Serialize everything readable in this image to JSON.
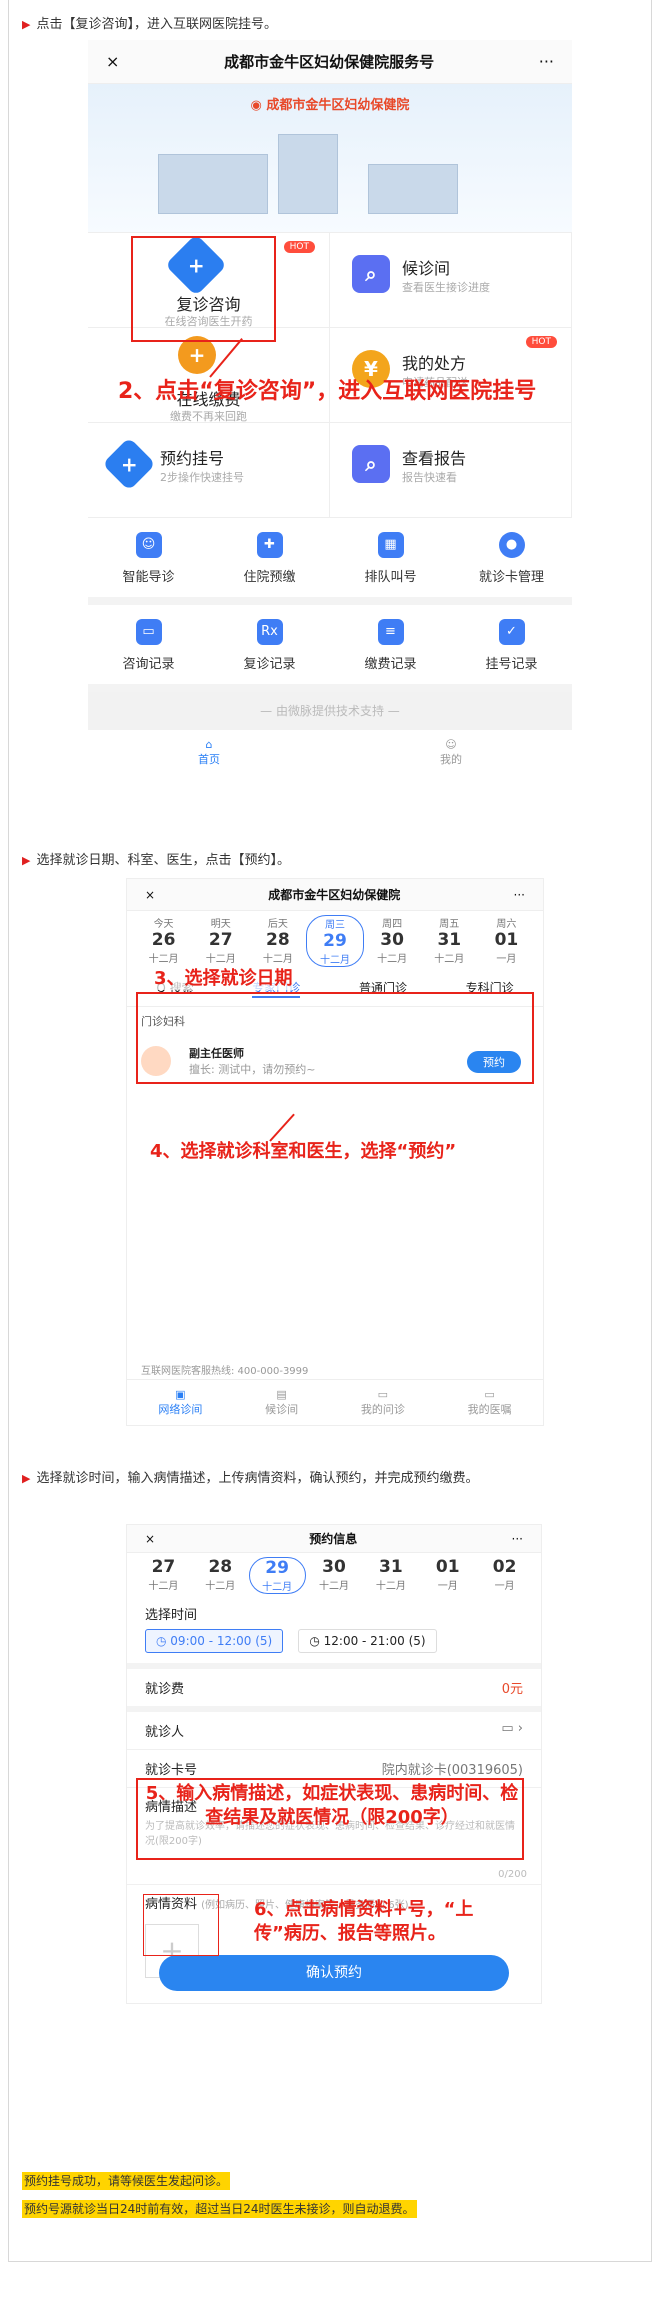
{
  "step1": {
    "caption": "点击【复诊咨询】，进入互联网医院挂号。",
    "nav": {
      "close": "×",
      "title": "成都市金牛区妇幼保健院服务号",
      "more": "···"
    },
    "brand": "成都市金牛区妇幼保健院",
    "tiles": [
      {
        "title": "复诊咨询",
        "sub": "在线咨询医生开药",
        "badge": "HOT"
      },
      {
        "title": "候诊间",
        "sub": "查看医生接诊进度"
      },
      {
        "title": "我的处方",
        "sub": "申请药品配送",
        "badge": "HOT"
      },
      {
        "title": "预约挂号",
        "sub": "2步操作快速挂号"
      },
      {
        "title": "在线缴费",
        "sub": "缴费不再来回跑"
      },
      {
        "title": "查看报告",
        "sub": "报告快速看"
      }
    ],
    "row1": [
      "智能导诊",
      "住院预缴",
      "排队叫号",
      "就诊卡管理"
    ],
    "row2": [
      "咨询记录",
      "复诊记录",
      "缴费记录",
      "挂号记录"
    ],
    "support": "— 由微脉提供技术支持 —",
    "tabs": [
      "首页",
      "我的"
    ],
    "annotation": "2、点击“复诊咨询”，进入互联网医院挂号"
  },
  "step2": {
    "caption": "选择就诊日期、科室、医生，点击【预约】。",
    "nav": {
      "close": "×",
      "title": "成都市金牛区妇幼保健院",
      "more": "···"
    },
    "days": [
      {
        "w": "今天",
        "d": "26",
        "l": "十二月"
      },
      {
        "w": "明天",
        "d": "27",
        "l": "十二月"
      },
      {
        "w": "后天",
        "d": "28",
        "l": "十二月"
      },
      {
        "w": "周三",
        "d": "29",
        "l": "十二月"
      },
      {
        "w": "周四",
        "d": "30",
        "l": "十二月"
      },
      {
        "w": "周五",
        "d": "31",
        "l": "十二月"
      },
      {
        "w": "周六",
        "d": "01",
        "l": "一月"
      }
    ],
    "search": "Q 搜索",
    "tabs": [
      "专家门诊",
      "普通门诊",
      "专科门诊"
    ],
    "dept": "门诊妇科",
    "doctor_title": "副主任医师",
    "doctor_note": "擅长: 测试中，请勿预约~",
    "book": "预约",
    "hotline": "互联网医院客服热线: 400-000-3999",
    "bottom_tabs": [
      "网络诊间",
      "候诊间",
      "我的问诊",
      "我的医嘱"
    ],
    "annotation_a": "3、选择就诊日期",
    "annotation_b": "4、选择就诊科室和医生，选择“预约”"
  },
  "step3": {
    "caption": "选择就诊时间，输入病情描述，上传病情资料，确认预约，并完成预约缴费。",
    "nav": {
      "close": "×",
      "title": "预约信息",
      "more": "···"
    },
    "days": [
      {
        "d": "27",
        "l": "十二月"
      },
      {
        "d": "28",
        "l": "十二月"
      },
      {
        "d": "29",
        "l": "十二月"
      },
      {
        "d": "30",
        "l": "十二月"
      },
      {
        "d": "31",
        "l": "十二月"
      },
      {
        "d": "01",
        "l": "一月"
      },
      {
        "d": "02",
        "l": "一月"
      }
    ],
    "time_label": "选择时间",
    "slots": [
      "09:00 - 12:00 (5)",
      "12:00 - 21:00 (5)"
    ],
    "fee_label": "就诊费",
    "fee": "0元",
    "patient_label": "就诊人",
    "card_label": "就诊卡号",
    "card": "院内就诊卡(00319605)",
    "desc_label": "病情描述",
    "desc_placeholder": "为了提高就诊效率，请描述您的症状表现、患病时间、检查结果、诊疗经过和就医情况(限200字)",
    "counter": "0/200",
    "material_label": "病情资料",
    "material_hint": "(例如病历、照片、健康档案等，最多添加 6张)",
    "confirm": "确认预约",
    "annotation_a": "5、输入病情描述，如症状表现、患病时间、检查结果及就医情况（限200字）",
    "annotation_b": "6、点击病情资料+号，“上传”病历、报告等照片。"
  },
  "notices": [
    "预约挂号成功，请等候医生发起问诊。",
    "预约号源就诊当日24时前有效，超过当日24时医生未接诊，则自动退费。"
  ]
}
